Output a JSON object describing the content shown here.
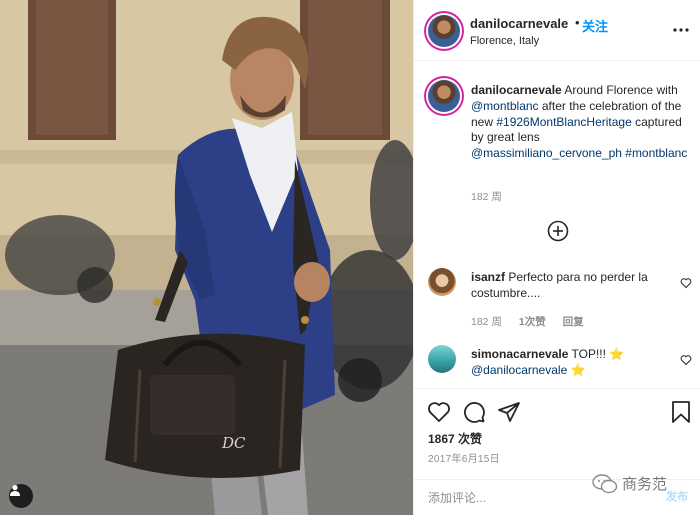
{
  "post": {
    "username": "danilocarnevale",
    "separator": "•",
    "follow_label": "关注",
    "location": "Florence, Italy",
    "monogram": "DC"
  },
  "caption": {
    "username": "danilocarnevale",
    "line1": " Around Florence with",
    "mention1": "@montblanc",
    "line2": " after the celebration of the new ",
    "hashtag1": "#1926MontBlancHeritage",
    "line3": " captured by great lens ",
    "mention2": "@massimiliano_cervone_ph",
    "hashtag2": "#montblanc",
    "age": "182 周"
  },
  "comments": [
    {
      "username": "isanzf",
      "text": " Perfecto para no perder la costumbre....",
      "age": "182 周",
      "likes": "1次赞",
      "reply": "回复"
    },
    {
      "username": "simonacarnevale",
      "text": " TOP!!! ",
      "star1": "⭐",
      "mention": "@danilocarnevale",
      "star2": "⭐"
    }
  ],
  "actions": {
    "likes_count": "1867 次赞",
    "date": "2017年6月15日",
    "comment_placeholder": "添加评论...",
    "post_label": "发布"
  },
  "watermark": {
    "text": "商务范"
  },
  "colors": {
    "accent": "#0095f6",
    "link": "#00376b",
    "muted": "#8e8e8e",
    "story_ring": "#d6249f",
    "star": "#f7c21c"
  }
}
